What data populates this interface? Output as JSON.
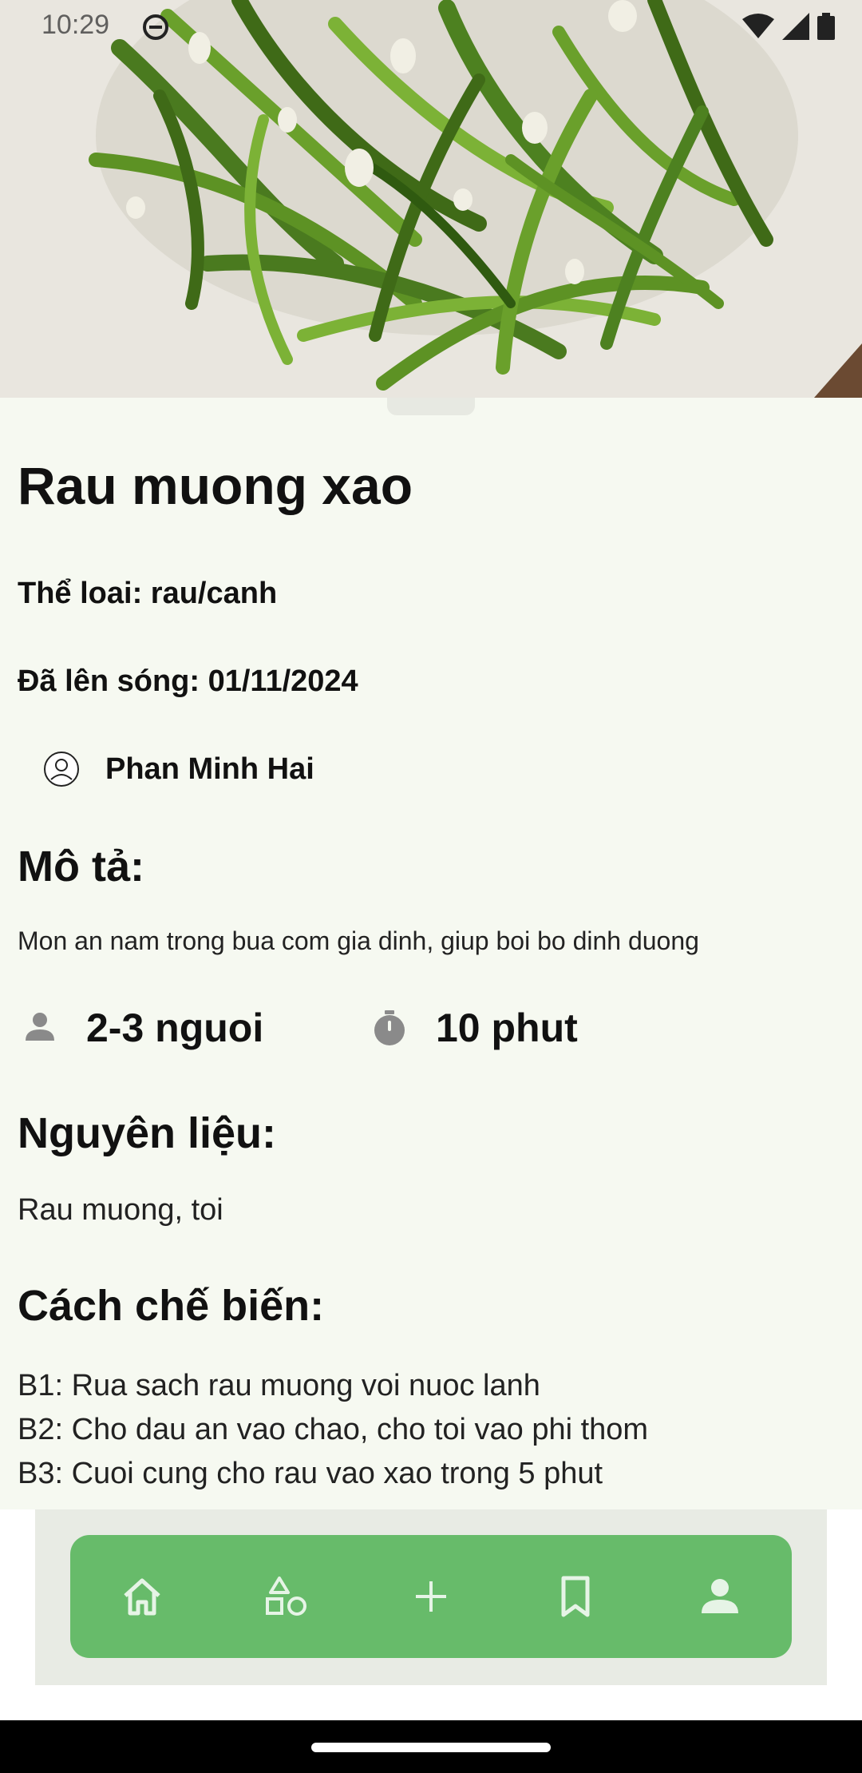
{
  "status_bar": {
    "time": "10:29",
    "icons": [
      "do-not-disturb-icon",
      "wifi-icon",
      "cell-signal-icon",
      "battery-icon"
    ]
  },
  "recipe": {
    "title": "Rau muong xao",
    "category": "Thể loai: rau/canh",
    "published": "Đã lên sóng: 01/11/2024",
    "author": "Phan Minh Hai",
    "description_heading": "Mô tả:",
    "description": "Mon an nam trong bua com gia dinh, giup boi bo dinh duong",
    "servings": "2-3 nguoi",
    "cook_time": "10 phut",
    "ingredients_heading": "Nguyên liệu:",
    "ingredients": "Rau muong, toi",
    "method_heading": "Cách chế biến:",
    "steps": [
      "B1: Rua sach rau muong voi nuoc lanh",
      "B2: Cho dau an vao chao, cho toi vao phi thom",
      "B3: Cuoi cung cho rau vao xao trong 5 phut"
    ]
  },
  "bottom_nav": {
    "items": [
      "home-icon",
      "categories-icon",
      "add-icon",
      "bookmark-icon",
      "profile-icon"
    ],
    "active": "home-icon"
  },
  "colors": {
    "sheet_background": "#f6f9f1",
    "nav_accent": "#67bb6a",
    "nav_icon": "#e6f4e6",
    "info_icon": "#8a8a8a"
  }
}
